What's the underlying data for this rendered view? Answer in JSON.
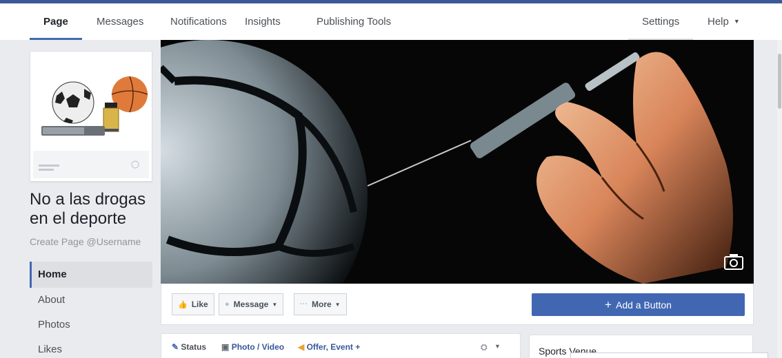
{
  "tabs": {
    "page": "Page",
    "messages": "Messages",
    "notifications": "Notifications",
    "insights": "Insights",
    "publishing_tools": "Publishing Tools",
    "settings": "Settings",
    "help": "Help"
  },
  "page": {
    "name": "No a las drogas en el deporte",
    "username_prompt": "Create Page @Username"
  },
  "nav": {
    "home": "Home",
    "about": "About",
    "photos": "Photos",
    "likes": "Likes"
  },
  "actions": {
    "like": "Like",
    "message": "Message",
    "more": "More",
    "add_button": "Add a Button"
  },
  "composer": {
    "status": "Status",
    "photo_video": "Photo / Video",
    "offer_event": "Offer, Event +"
  },
  "sidebar": {
    "category": "Sports Venue"
  },
  "colors": {
    "brand_blue": "#4267b2",
    "top_border": "#3b5998",
    "background": "#e9ebee"
  }
}
